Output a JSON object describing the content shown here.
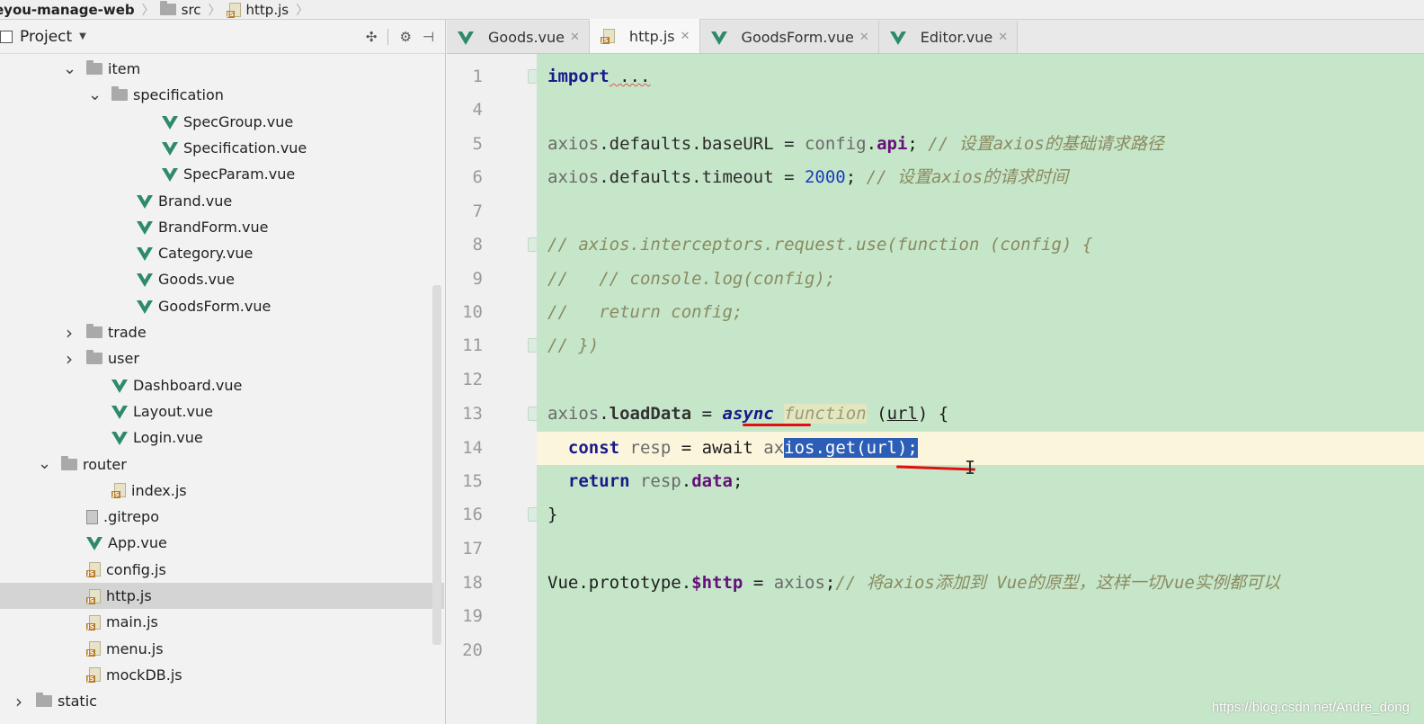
{
  "breadcrumb": {
    "project": "eyou-manage-web",
    "folder": "src",
    "file": "http.js"
  },
  "project_panel": {
    "title": "Project",
    "icons": [
      "project-icon",
      "dropdown-icon",
      "collapse-all-icon",
      "settings-icon",
      "hide-panel-icon"
    ],
    "tree": [
      {
        "label": "item",
        "type": "folder",
        "expanded": true
      },
      {
        "label": "specification",
        "type": "folder",
        "expanded": true
      },
      {
        "label": "SpecGroup.vue",
        "type": "vue"
      },
      {
        "label": "Specification.vue",
        "type": "vue"
      },
      {
        "label": "SpecParam.vue",
        "type": "vue"
      },
      {
        "label": "Brand.vue",
        "type": "vue"
      },
      {
        "label": "BrandForm.vue",
        "type": "vue"
      },
      {
        "label": "Category.vue",
        "type": "vue"
      },
      {
        "label": "Goods.vue",
        "type": "vue"
      },
      {
        "label": "GoodsForm.vue",
        "type": "vue"
      },
      {
        "label": "trade",
        "type": "folder",
        "expanded": false
      },
      {
        "label": "user",
        "type": "folder",
        "expanded": false
      },
      {
        "label": "Dashboard.vue",
        "type": "vue"
      },
      {
        "label": "Layout.vue",
        "type": "vue"
      },
      {
        "label": "Login.vue",
        "type": "vue"
      },
      {
        "label": "router",
        "type": "folder",
        "expanded": true
      },
      {
        "label": "index.js",
        "type": "js"
      },
      {
        "label": ".gitrepo",
        "type": "file"
      },
      {
        "label": "App.vue",
        "type": "vue"
      },
      {
        "label": "config.js",
        "type": "js"
      },
      {
        "label": "http.js",
        "type": "js",
        "selected": true
      },
      {
        "label": "main.js",
        "type": "js"
      },
      {
        "label": "menu.js",
        "type": "js"
      },
      {
        "label": "mockDB.js",
        "type": "js"
      },
      {
        "label": "static",
        "type": "folder",
        "expanded": false
      }
    ]
  },
  "tabs": [
    {
      "label": "Goods.vue",
      "type": "vue",
      "active": false
    },
    {
      "label": "http.js",
      "type": "js",
      "active": true
    },
    {
      "label": "GoodsForm.vue",
      "type": "vue",
      "active": false
    },
    {
      "label": "Editor.vue",
      "type": "vue",
      "active": false
    }
  ],
  "editor": {
    "line_numbers": [
      "1",
      "4",
      "5",
      "6",
      "7",
      "8",
      "9",
      "10",
      "11",
      "12",
      "13",
      "14",
      "15",
      "16",
      "17",
      "18",
      "19",
      "20"
    ],
    "code": {
      "l1_kw": "import",
      "l1_rest": " ...",
      "l5_a": "axios",
      "l5_b": ".defaults.baseURL = ",
      "l5_c": "config",
      "l5_d": ".",
      "l5_e": "api",
      "l5_f": "; ",
      "l5_comment": "// 设置axios的基础请求路径",
      "l6_a": "axios",
      "l6_b": ".defaults.timeout = ",
      "l6_num": "2000",
      "l6_f": "; ",
      "l6_comment": "// 设置axios的请求时间",
      "l8": "// axios.interceptors.request.use(function (config) {",
      "l9": "//   // console.log(config);",
      "l10": "//   return config;",
      "l11": "// })",
      "l13_a": "axios",
      "l13_b": ".",
      "l13_c": "loadData",
      "l13_d": " = ",
      "l13_async": "async",
      "l13_sp": " ",
      "l13_function": "function",
      "l13_e": " (",
      "l13_url": "url",
      "l13_f": ") {",
      "l14_indent": "  ",
      "l14_const": "const",
      "l14_a": " ",
      "l14_resp": "resp",
      "l14_b": " = await ",
      "l14_ax": "ax",
      "l14_sel": "ios.get(url);",
      "l15_indent": "  ",
      "l15_return": "return",
      "l15_a": " ",
      "l15_resp": "resp",
      "l15_b": ".",
      "l15_data": "data",
      "l15_c": ";",
      "l16": "}",
      "l18_a": "Vue",
      "l18_b": ".prototype.",
      "l18_http": "$http",
      "l18_c": " = ",
      "l18_axios": "axios",
      "l18_d": ";",
      "l18_comment": "// 将axios添加到 Vue的原型，这样一切vue实例都可以"
    }
  },
  "watermark": "https://blog.csdn.net/Andre_dong",
  "colors": {
    "code_bg": "#c6e6c9",
    "selection": "#2c5eb8",
    "caret_line": "#fbf5dc",
    "annotation": "#e01010"
  }
}
